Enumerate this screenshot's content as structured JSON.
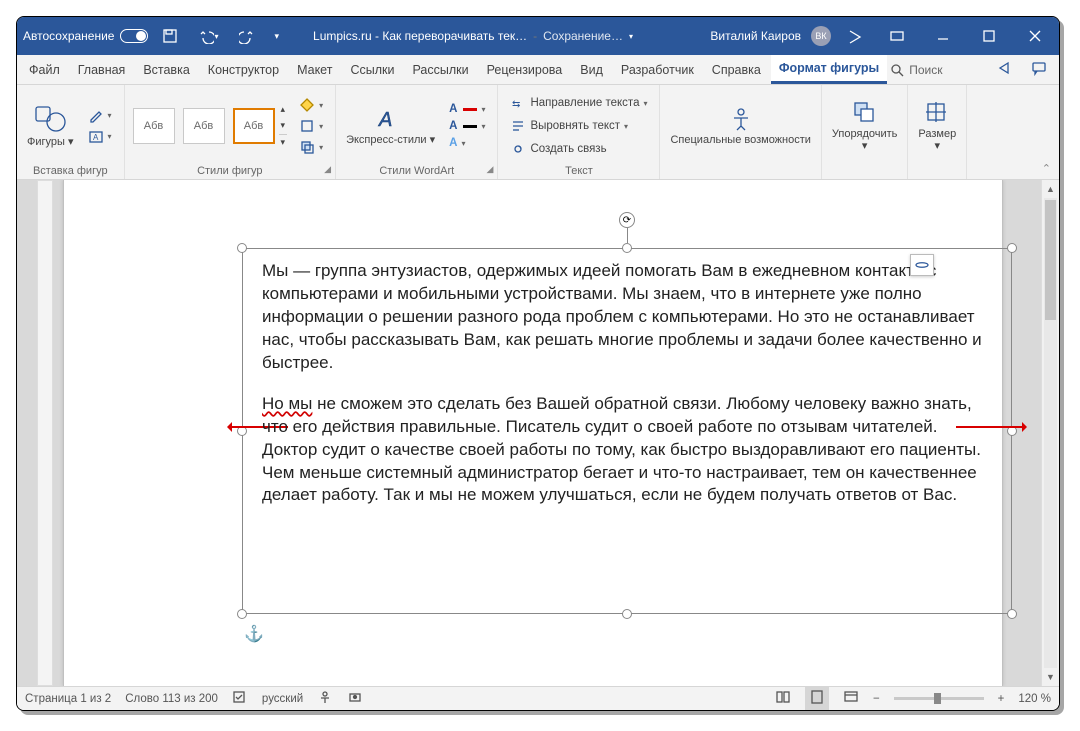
{
  "titlebar": {
    "autosave": "Автосохранение",
    "doc_title": "Lumpics.ru - Как переворачивать тек…",
    "saving": "Сохранение…",
    "user": "Виталий Каиров",
    "avatar": "ВК"
  },
  "tabs": {
    "file": "Файл",
    "home": "Главная",
    "insert": "Вставка",
    "design": "Конструктор",
    "layout": "Макет",
    "references": "Ссылки",
    "mailings": "Рассылки",
    "review": "Рецензирова",
    "view": "Вид",
    "developer": "Разработчик",
    "help": "Справка",
    "shape_format": "Формат фигуры",
    "search": "Поиск"
  },
  "ribbon": {
    "insert_shapes": {
      "shapes": "Фигуры",
      "label": "Вставка фигур"
    },
    "shape_styles": {
      "sample": "Абв",
      "label": "Стили фигур"
    },
    "wordart": {
      "express": "Экспресс-стили",
      "label": "Стили WordArt"
    },
    "text": {
      "direction": "Направление текста",
      "align": "Выровнять текст",
      "link": "Создать связь",
      "label": "Текст"
    },
    "accessibility": {
      "btn": "Специальные возможности",
      "label": ""
    },
    "arrange": {
      "btn": "Упорядочить"
    },
    "size": {
      "btn": "Размер"
    }
  },
  "document": {
    "para1": "Мы — группа энтузиастов, одержимых идеей помогать Вам в ежедневном контакте с компьютерами и мобильными устройствами. Мы знаем, что в интернете уже полно информации о решении разного рода проблем с компьютерами. Но это не останавливает нас, чтобы рассказывать Вам, как решать многие проблемы и задачи более качественно и быстрее.",
    "para2_pre": "Но мы",
    "para2_post": " не сможем это сделать без Вашей обратной связи. Любому человеку важно знать, что его действия правильные. Писатель судит о своей работе по отзывам читателей. Доктор судит о качестве своей работы по тому, как быстро выздоравливают его пациенты. Чем меньше системный администратор бегает и что-то настраивает, тем он качественнее делает работу. Так и мы не можем улучшаться, если не будем получать ответов от Вас."
  },
  "status": {
    "page": "Страница 1 из 2",
    "words": "Слово 113 из 200",
    "lang": "русский",
    "zoom": "120 %"
  }
}
